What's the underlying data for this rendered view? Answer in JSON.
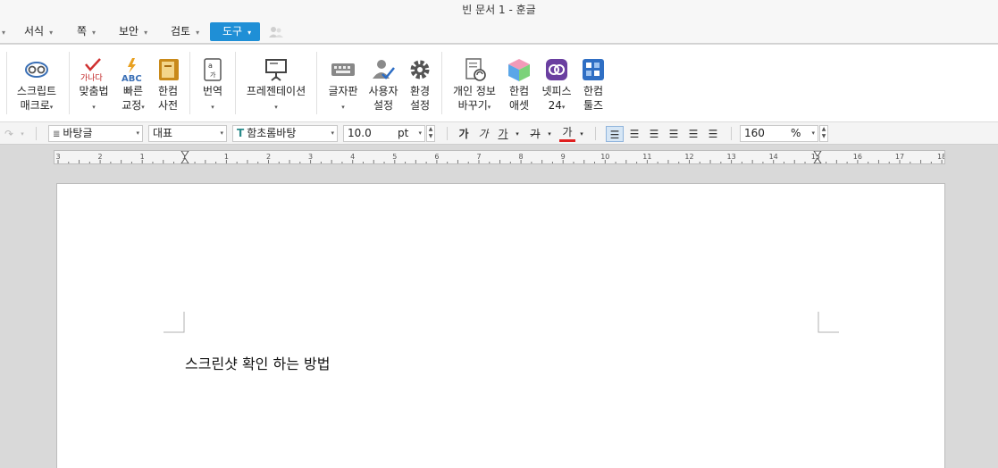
{
  "window": {
    "title": "빈 문서 1 - 훈글"
  },
  "menu": {
    "items": [
      {
        "label": "서식"
      },
      {
        "label": "쪽"
      },
      {
        "label": "보안"
      },
      {
        "label": "검토"
      },
      {
        "label": "도구"
      }
    ]
  },
  "ribbon": {
    "script_macro": {
      "line1": "스크립트",
      "line2": "매크로"
    },
    "spelling": {
      "line1": "맞춤법"
    },
    "quick_correct": {
      "line1": "빠른",
      "line2": "교정"
    },
    "hancom_dict": {
      "line1": "한컴",
      "line2": "사전"
    },
    "translate": {
      "line1": "번역"
    },
    "presentation": {
      "line1": "프레젠테이션"
    },
    "keyboard": {
      "line1": "글자판"
    },
    "user_settings": {
      "line1": "사용자",
      "line2": "설정"
    },
    "env_settings": {
      "line1": "환경",
      "line2": "설정"
    },
    "privacy": {
      "line1": "개인 정보",
      "line2": "바꾸기"
    },
    "hancom_asset": {
      "line1": "한컴",
      "line2": "애셋"
    },
    "netffice": {
      "line1": "넷피스",
      "line2": "24"
    },
    "hancom_tools": {
      "line1": "한컴",
      "line2": "툴즈"
    }
  },
  "format": {
    "style": "바탕글",
    "font_lang": "대표",
    "font_name": "함초롬바탕",
    "font_size": "10.0",
    "font_unit": "pt",
    "bold_glyph": "가",
    "italic_glyph": "가",
    "underline_glyph": "가",
    "strike_glyph": "가",
    "color_glyph": "가",
    "zoom_value": "160",
    "zoom_unit": "%",
    "text_color": "#e02020"
  },
  "ruler": {
    "labels": [
      "3",
      "2",
      "1",
      "1",
      "1",
      "2",
      "3",
      "4",
      "5",
      "6",
      "7",
      "8",
      "9",
      "10",
      "11",
      "12",
      "13",
      "14",
      "15",
      "16",
      "17",
      "18"
    ]
  },
  "document": {
    "text": "스크린샷 확인 하는 방법"
  },
  "colors": {
    "accent": "#1f8fd6"
  }
}
